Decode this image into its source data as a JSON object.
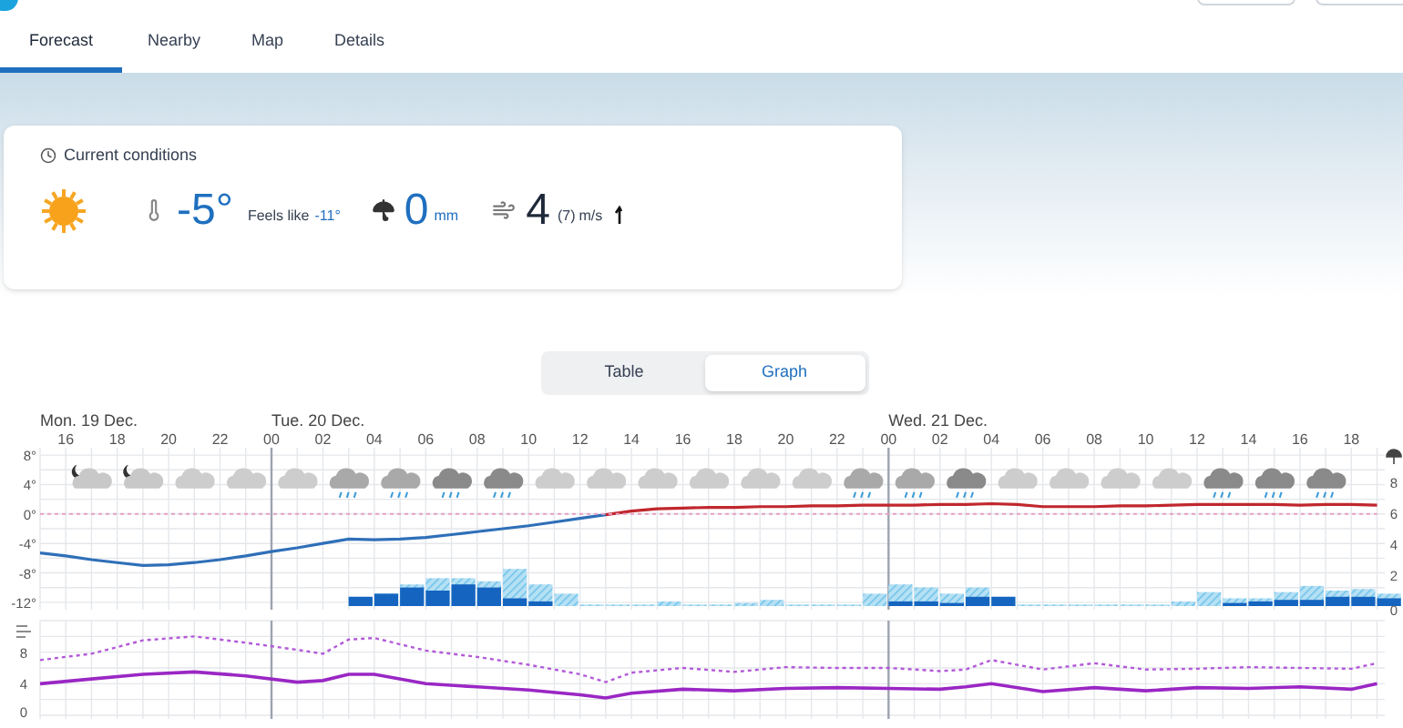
{
  "tabs": [
    {
      "label": "Forecast",
      "selected": true
    },
    {
      "label": "Nearby",
      "selected": false
    },
    {
      "label": "Map",
      "selected": false
    },
    {
      "label": "Details",
      "selected": false
    }
  ],
  "current_conditions": {
    "title": "Current conditions",
    "temperature": "-5°",
    "feels_like_label": "Feels like",
    "feels_like": "-11°",
    "precipitation": "0",
    "precipitation_unit": "mm",
    "wind": "4",
    "gust": "(7)",
    "wind_unit": "m/s"
  },
  "view_toggle": [
    {
      "label": "Table",
      "selected": false
    },
    {
      "label": "Graph",
      "selected": true
    }
  ],
  "weather_icons": [
    {
      "kind": "night"
    },
    {
      "kind": "night"
    },
    {
      "kind": "cloud"
    },
    {
      "kind": "cloud"
    },
    {
      "kind": "cloud"
    },
    {
      "kind": "light-rain"
    },
    {
      "kind": "light-rain"
    },
    {
      "kind": "rain"
    },
    {
      "kind": "rain"
    },
    {
      "kind": "cloud"
    },
    {
      "kind": "cloud"
    },
    {
      "kind": "cloud"
    },
    {
      "kind": "cloud"
    },
    {
      "kind": "cloud"
    },
    {
      "kind": "cloud"
    },
    {
      "kind": "light-rain"
    },
    {
      "kind": "light-rain"
    },
    {
      "kind": "rain"
    },
    {
      "kind": "cloud"
    },
    {
      "kind": "cloud"
    },
    {
      "kind": "cloud"
    },
    {
      "kind": "cloud"
    },
    {
      "kind": "rain"
    },
    {
      "kind": "rain"
    },
    {
      "kind": "rain"
    }
  ],
  "temperature_chart": {
    "chart_data": {
      "type": "line",
      "grid": true,
      "xlim": [
        15,
        67.3
      ],
      "ylim": [
        -13,
        9
      ],
      "x": [
        15,
        16,
        17,
        18,
        19,
        20,
        21,
        22,
        23,
        24,
        25,
        26,
        27,
        28,
        29,
        30,
        31,
        32,
        33,
        34,
        35,
        36,
        37,
        38,
        39,
        40,
        41,
        42,
        43,
        44,
        45,
        46,
        47,
        48,
        49,
        50,
        51,
        52,
        53,
        54,
        55,
        56,
        57,
        58,
        59,
        60,
        61,
        62,
        63,
        64,
        65,
        66,
        67
      ],
      "series": [
        {
          "color": "#2f6fb8",
          "values": [
            -5.3,
            -5.7,
            -6.2,
            -6.6,
            -7,
            -6.9,
            -6.6,
            -6.2,
            -5.7,
            -5.1,
            -4.6,
            -4,
            -3.4,
            -3.5,
            -3.4,
            -3.2,
            -2.8,
            -2.4,
            -2,
            -1.6,
            -1.1,
            -0.6,
            -0.1,
            null,
            null,
            null,
            null,
            null,
            null,
            null,
            null,
            null,
            null,
            null,
            null,
            null,
            null,
            null,
            null,
            null,
            null,
            null,
            null,
            null,
            null,
            null,
            null,
            null,
            null,
            null,
            null,
            null,
            null
          ]
        },
        {
          "color": "#c0272d",
          "values": [
            null,
            null,
            null,
            null,
            null,
            null,
            null,
            null,
            null,
            null,
            null,
            null,
            null,
            null,
            null,
            null,
            null,
            null,
            null,
            null,
            null,
            null,
            -0.1,
            0.4,
            0.7,
            0.8,
            0.9,
            0.9,
            1,
            1,
            1.1,
            1.1,
            1.2,
            1.2,
            1.2,
            1.3,
            1.3,
            1.4,
            1.3,
            1,
            1,
            1,
            1.1,
            1.1,
            1.2,
            1.3,
            1.3,
            1.3,
            1.3,
            1.2,
            1.3,
            1.3,
            1.2
          ]
        },
        {
          "color": "#e7a0c4",
          "line_style": "dotted",
          "values": [
            0,
            0,
            0,
            0,
            0,
            0,
            0,
            0,
            0,
            0,
            0,
            0,
            0,
            0,
            0,
            0,
            0,
            0,
            0,
            0,
            0,
            0,
            0,
            0,
            0,
            0,
            0,
            0,
            0,
            0,
            0,
            0,
            0,
            0,
            0,
            0,
            0,
            0,
            0,
            0,
            0,
            0,
            0,
            0,
            0,
            0,
            0,
            0,
            0,
            0,
            0,
            0,
            0
          ]
        }
      ],
      "xticks": [
        {
          "value": 16,
          "label": "16"
        },
        {
          "value": 18,
          "label": "18"
        },
        {
          "value": 20,
          "label": "20"
        },
        {
          "value": 22,
          "label": "22"
        },
        {
          "value": 24,
          "label": "00"
        },
        {
          "value": 26,
          "label": "02"
        },
        {
          "value": 28,
          "label": "04"
        },
        {
          "value": 30,
          "label": "06"
        },
        {
          "value": 32,
          "label": "08"
        },
        {
          "value": 34,
          "label": "10"
        },
        {
          "value": 36,
          "label": "12"
        },
        {
          "value": 38,
          "label": "14"
        },
        {
          "value": 40,
          "label": "16"
        },
        {
          "value": 42,
          "label": "18"
        },
        {
          "value": 44,
          "label": "20"
        },
        {
          "value": 46,
          "label": "22"
        },
        {
          "value": 48,
          "label": "00"
        },
        {
          "value": 50,
          "label": "02"
        },
        {
          "value": 52,
          "label": "04"
        },
        {
          "value": 54,
          "label": "06"
        },
        {
          "value": 56,
          "label": "08"
        },
        {
          "value": 58,
          "label": "10"
        },
        {
          "value": 60,
          "label": "12"
        },
        {
          "value": 62,
          "label": "14"
        },
        {
          "value": 64,
          "label": "16"
        },
        {
          "value": 66,
          "label": "18"
        }
      ],
      "yticks": [
        {
          "value": 8,
          "label": "8°"
        },
        {
          "value": 4,
          "label": "4°"
        },
        {
          "value": 0,
          "label": "0°"
        },
        {
          "value": -4,
          "label": "-4°"
        },
        {
          "value": -8,
          "label": "-8°"
        },
        {
          "value": -12,
          "label": "-12°"
        }
      ],
      "annotations": [
        "Mon. 19 Dec.",
        "Tue. 20 Dec.",
        "Wed. 21 Dec."
      ]
    }
  },
  "precipitation_axis": {
    "labels": [
      "8",
      "6",
      "4",
      "2",
      "0"
    ]
  },
  "wind_chart": {
    "chart_data": {
      "type": "line",
      "grid": true,
      "xlim": [
        15,
        67.3
      ],
      "ylim": [
        0,
        12
      ],
      "x": [
        15,
        17,
        19,
        21,
        23,
        25,
        26,
        27,
        28,
        30,
        32,
        34,
        36,
        37,
        38,
        40,
        42,
        44,
        46,
        48,
        50,
        51,
        52,
        54,
        56,
        58,
        60,
        62,
        64,
        66,
        67
      ],
      "series": [
        {
          "color": "#b25ad8",
          "line_style": "dashed",
          "values": [
            7,
            7.8,
            9.5,
            10,
            9.2,
            8.3,
            7.8,
            9.6,
            9.8,
            8.2,
            7.4,
            6.4,
            5.2,
            4.2,
            5.4,
            6,
            5.5,
            6.1,
            6,
            6,
            5.6,
            5.8,
            7,
            5.8,
            6.6,
            5.8,
            5.9,
            6.1,
            6,
            5.9,
            6.6
          ]
        },
        {
          "color": "#9a27c4",
          "line_style": "solid",
          "values": [
            4,
            4.6,
            5.2,
            5.5,
            5,
            4.2,
            4.4,
            5.2,
            5.2,
            4,
            3.6,
            3.2,
            2.6,
            2.2,
            2.8,
            3.3,
            3.1,
            3.4,
            3.5,
            3.4,
            3.3,
            3.6,
            4,
            3,
            3.5,
            3.1,
            3.5,
            3.4,
            3.6,
            3.3,
            4
          ]
        }
      ],
      "yticks": [
        8,
        4,
        0
      ]
    }
  }
}
